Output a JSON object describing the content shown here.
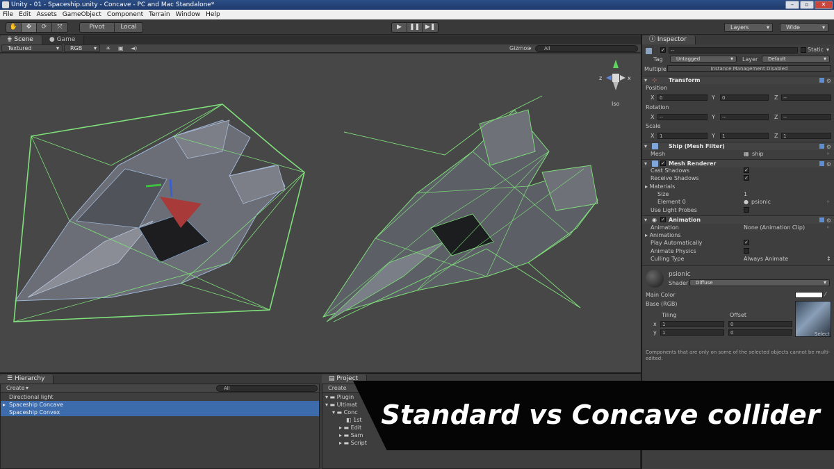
{
  "window": {
    "title": "Unity - 01 - Spaceship.unity - Concave - PC and Mac Standalone*",
    "buttons": [
      "–",
      "▫",
      "✕"
    ]
  },
  "menu": [
    "File",
    "Edit",
    "Assets",
    "GameObject",
    "Component",
    "Terrain",
    "Window",
    "Help"
  ],
  "toolbar": {
    "tools": [
      "✋",
      "✥",
      "⟳",
      "⤧"
    ],
    "pivot": "Pivot",
    "local": "Local",
    "play": "▶",
    "pause": "❚❚",
    "step": "▶❚",
    "layers": "Layers",
    "layout": "Wide"
  },
  "scene": {
    "tabs": [
      "Scene",
      "Game"
    ],
    "draw_mode": "Textured",
    "render_mode": "RGB",
    "gizmos": "Gizmos",
    "search_placeholder": "All",
    "gizmo_label": "Iso",
    "axis_z": "z",
    "axis_x": "x"
  },
  "hierarchy": {
    "tab": "Hierarchy",
    "create": "Create",
    "search_placeholder": "All",
    "items": [
      "Directional light",
      "Spaceship Concave",
      "Spaceship Convex"
    ]
  },
  "project": {
    "tab": "Project",
    "create": "Create",
    "items": [
      "Plugin",
      "Ultimat",
      "Conc",
      "1st",
      "Edit",
      "Sam",
      "Script"
    ]
  },
  "inspector": {
    "tab": "Inspector",
    "name_field": "--",
    "static": "Static",
    "tag_label": "Tag",
    "tag_value": "Untagged",
    "layer_label": "Layer",
    "layer_value": "Default",
    "multiple_label": "Multiple",
    "multiple_value": "Instance Management Disabled",
    "transform": {
      "title": "Transform",
      "position": "Position",
      "rotation": "Rotation",
      "scale": "Scale",
      "x": "X",
      "y": "Y",
      "z": "Z",
      "pos_x": "0",
      "pos_y": "0",
      "pos_z": "--",
      "rot_x": "--",
      "rot_y": "--",
      "rot_z": "--",
      "scale_x": "1",
      "scale_y": "1",
      "scale_z": "1"
    },
    "mesh_filter": {
      "title": "Ship (Mesh Filter)",
      "mesh_label": "Mesh",
      "mesh_value": "ship"
    },
    "mesh_renderer": {
      "title": "Mesh Renderer",
      "cast_shadows": "Cast Shadows",
      "receive_shadows": "Receive Shadows",
      "materials": "Materials",
      "size": "Size",
      "size_value": "1",
      "element0": "Element 0",
      "element0_value": "psionic",
      "light_probes": "Use Light Probes"
    },
    "animation": {
      "title": "Animation",
      "animation": "Animation",
      "animation_value": "None (Animation Clip)",
      "animations": "Animations",
      "play_auto": "Play Automatically",
      "animate_physics": "Animate Physics",
      "culling": "Culling Type",
      "culling_value": "Always Animate"
    },
    "material": {
      "name": "psionic",
      "shader_label": "Shader",
      "shader_value": "Diffuse",
      "main_color": "Main Color",
      "base": "Base (RGB)",
      "tiling": "Tiling",
      "offset": "Offset",
      "x": "x",
      "y": "y",
      "tile_x": "1",
      "tile_y": "1",
      "off_x": "0",
      "off_y": "0",
      "select": "Select"
    },
    "note": "Components that are only on some of the selected objects cannot be multi-edited."
  },
  "banner": {
    "text": "Standard vs Concave collider"
  },
  "colors": {
    "collider": "#7fe07a",
    "selection": "#3c6cab",
    "banner_bg": "#050505"
  }
}
